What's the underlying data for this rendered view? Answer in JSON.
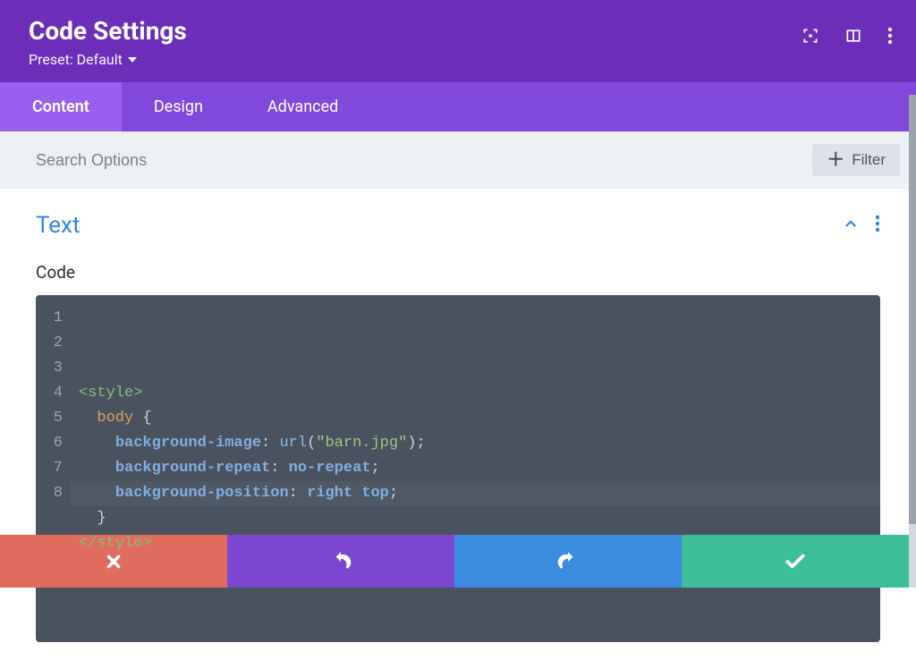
{
  "header": {
    "title": "Code Settings",
    "preset": "Preset: Default"
  },
  "tabs": [
    {
      "label": "Content",
      "active": true
    },
    {
      "label": "Design",
      "active": false
    },
    {
      "label": "Advanced",
      "active": false
    }
  ],
  "search": {
    "placeholder": "Search Options",
    "filter_label": "Filter"
  },
  "section": {
    "title": "Text",
    "field_label": "Code"
  },
  "code": {
    "line_count": 8,
    "lines": [
      [
        {
          "t": "tag",
          "v": "<style>"
        }
      ],
      [
        {
          "t": "plain",
          "v": "  "
        },
        {
          "t": "sel",
          "v": "body"
        },
        {
          "t": "plain",
          "v": " "
        },
        {
          "t": "punct",
          "v": "{"
        }
      ],
      [
        {
          "t": "plain",
          "v": "    "
        },
        {
          "t": "prop",
          "v": "background-image"
        },
        {
          "t": "punct",
          "v": ": "
        },
        {
          "t": "func",
          "v": "url"
        },
        {
          "t": "punct",
          "v": "("
        },
        {
          "t": "str",
          "v": "\"barn.jpg\""
        },
        {
          "t": "punct",
          "v": ");"
        }
      ],
      [
        {
          "t": "plain",
          "v": "    "
        },
        {
          "t": "prop",
          "v": "background-repeat"
        },
        {
          "t": "punct",
          "v": ": "
        },
        {
          "t": "val",
          "v": "no-repeat"
        },
        {
          "t": "punct",
          "v": ";"
        }
      ],
      [
        {
          "t": "plain",
          "v": "    "
        },
        {
          "t": "prop",
          "v": "background-position"
        },
        {
          "t": "punct",
          "v": ": "
        },
        {
          "t": "val",
          "v": "right"
        },
        {
          "t": "punct",
          "v": " "
        },
        {
          "t": "val",
          "v": "top"
        },
        {
          "t": "punct",
          "v": ";"
        }
      ],
      [
        {
          "t": "plain",
          "v": "  "
        },
        {
          "t": "punct",
          "v": "}"
        }
      ],
      [
        {
          "t": "tag",
          "v": "</style>"
        }
      ],
      []
    ]
  },
  "footer": {
    "cancel": "cancel",
    "undo": "undo",
    "redo": "redo",
    "save": "save"
  },
  "colors": {
    "header_bg": "#6c2eb9",
    "tabs_bg": "#8049db",
    "tab_active_bg": "#9b5ff0",
    "cancel": "#e06b5f",
    "undo": "#7c47d0",
    "redo": "#3b8be0",
    "save": "#3dbf99",
    "editor_bg": "#4a5260",
    "link": "#2e87e8"
  }
}
